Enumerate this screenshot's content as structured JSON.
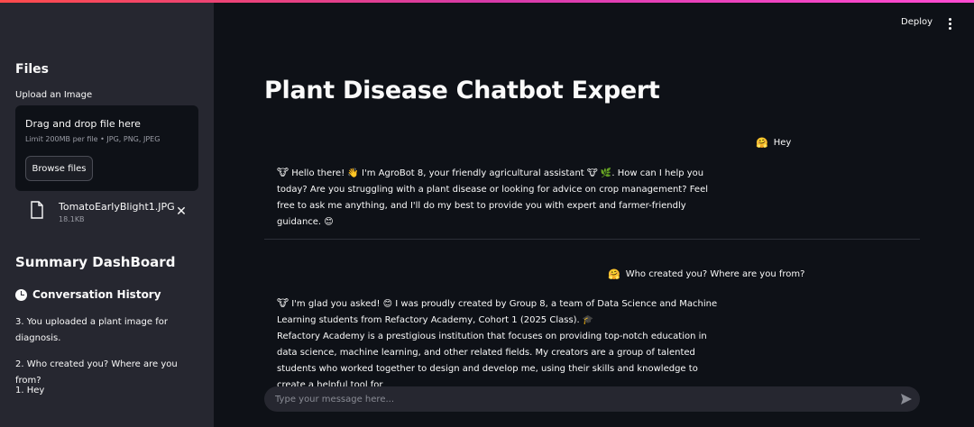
{
  "sidebar": {
    "files_title": "Files",
    "upload_label": "Upload an Image",
    "dropzone_title": "Drag and drop file here",
    "dropzone_sub": "Limit 200MB per file • JPG, PNG, JPEG",
    "browse_label": "Browse files",
    "file": {
      "name": "TomatoEarlyBlight1.JPG",
      "size": "18.1KB",
      "close": "✕"
    },
    "dashboard_title": "Summary DashBoard",
    "history_title": "Conversation History",
    "history": [
      "3. You uploaded a plant image for diagnosis.",
      "2. Who created you? Where are you from?",
      "1. Hey"
    ]
  },
  "header": {
    "deploy_label": "Deploy"
  },
  "main": {
    "title": "Plant Disease Chatbot Expert",
    "messages": [
      {
        "role": "user",
        "emoji": "🤗",
        "text": "Hey"
      },
      {
        "role": "assistant",
        "emoji": "🐮",
        "text": "Hello there! 👋 I'm AgroBot 8, your friendly agricultural assistant 🐮 🌿. How can I help you today? Are you struggling with a plant disease or looking for advice on crop management? Feel free to ask me anything, and I'll do my best to provide you with expert and farmer-friendly guidance. 😊"
      },
      {
        "role": "user",
        "emoji": "🤗",
        "text": "Who created you? Where are you from?"
      },
      {
        "role": "assistant",
        "emoji": "🐮",
        "text": "I'm glad you asked! 😊 I was proudly created by Group 8, a team of Data Science and Machine Learning students from Refactory Academy, Cohort 1 (2025 Class). 🎓",
        "text2": "Refactory Academy is a prestigious institution that focuses on providing top-notch education in data science, machine learning, and other related fields. My creators are a group of talented students who worked together to design and develop me, using their skills and knowledge to create a helpful tool for"
      }
    ],
    "input_placeholder": "Type your message here..."
  }
}
